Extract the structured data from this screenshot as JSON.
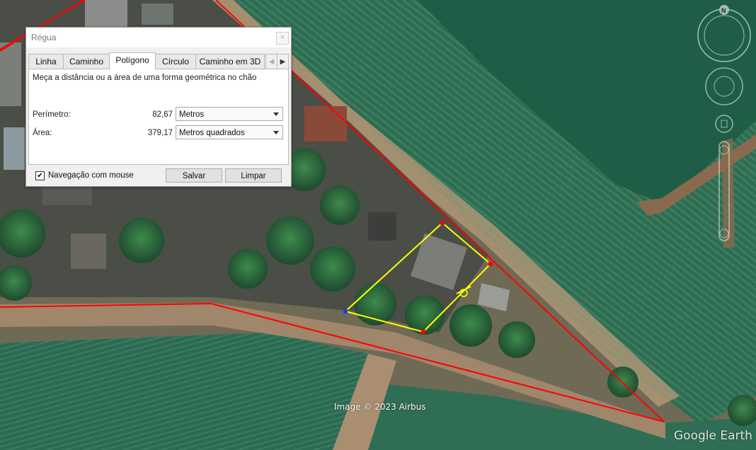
{
  "dialog": {
    "title": "Régua",
    "close_glyph": "×",
    "tabs": [
      "Linha",
      "Caminho",
      "Polígono",
      "Círculo",
      "Caminho em 3D"
    ],
    "active_tab": "Polígono",
    "description": "Meça a distância ou a área de uma forma geométrica no chão",
    "perimeter": {
      "label": "Perímetro:",
      "value": "82,67",
      "unit": "Metros"
    },
    "area": {
      "label": "Área:",
      "value": "379,17",
      "unit": "Metros quadrados"
    },
    "mouse_nav": {
      "label": "Navegação com mouse",
      "checked": true
    },
    "save_label": "Salvar",
    "clear_label": "Limpar"
  },
  "map": {
    "credit": "Image © 2023 Airbus",
    "brand": "Google Earth",
    "compass_letter": "N",
    "colors": {
      "boundary": "#ff0000",
      "polygon": "#ffff00",
      "vertex": "#ff0000",
      "start_vertex": "#1a3cff"
    }
  }
}
